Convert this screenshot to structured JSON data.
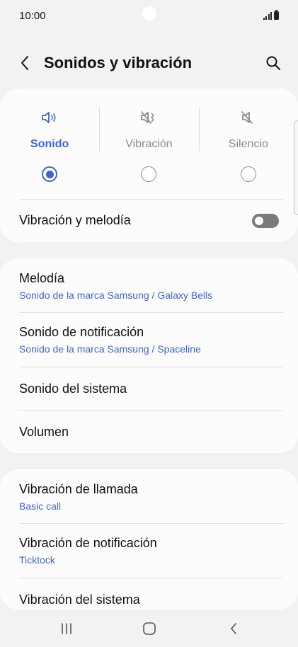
{
  "status_bar": {
    "time": "10:00"
  },
  "header": {
    "title": "Sonidos y vibración"
  },
  "sound_modes": [
    {
      "label": "Sonido",
      "selected": true
    },
    {
      "label": "Vibración",
      "selected": false
    },
    {
      "label": "Silencio",
      "selected": false
    }
  ],
  "vibrate_and_ring": {
    "label": "Vibración y melodía",
    "enabled": false
  },
  "settings": [
    {
      "title": "Melodía",
      "subtitle": "Sonido de la marca Samsung / Galaxy Bells"
    },
    {
      "title": "Sonido de notificación",
      "subtitle": "Sonido de la marca Samsung / Spaceline"
    },
    {
      "title": "Sonido del sistema"
    },
    {
      "title": "Volumen"
    }
  ],
  "vibration_settings": [
    {
      "title": "Vibración de llamada",
      "subtitle": "Basic call"
    },
    {
      "title": "Vibración de notificación",
      "subtitle": "Ticktock"
    },
    {
      "title": "Vibración del sistema"
    }
  ],
  "colors": {
    "accent": "#3f66c6",
    "background": "#f2f2f4",
    "card": "#fcfcfd"
  }
}
